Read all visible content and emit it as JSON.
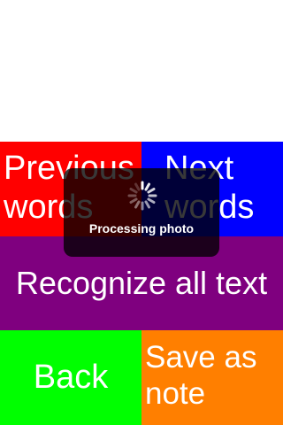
{
  "buttons": {
    "previous_words": "Previous\nwords",
    "next_words": "Next\nwords",
    "recognize_all_text": "Recognize all text",
    "back": "Back",
    "save_as_note": "Save as\nnote"
  },
  "hud": {
    "message": "Processing photo",
    "icon": "activity-spinner-icon"
  },
  "colors": {
    "previous_words": "#ff0000",
    "next_words": "#0000ff",
    "recognize_all_text": "#7f007f",
    "back": "#00ff00",
    "save_as_note": "#ff7f00",
    "hud_background": "#000000"
  }
}
